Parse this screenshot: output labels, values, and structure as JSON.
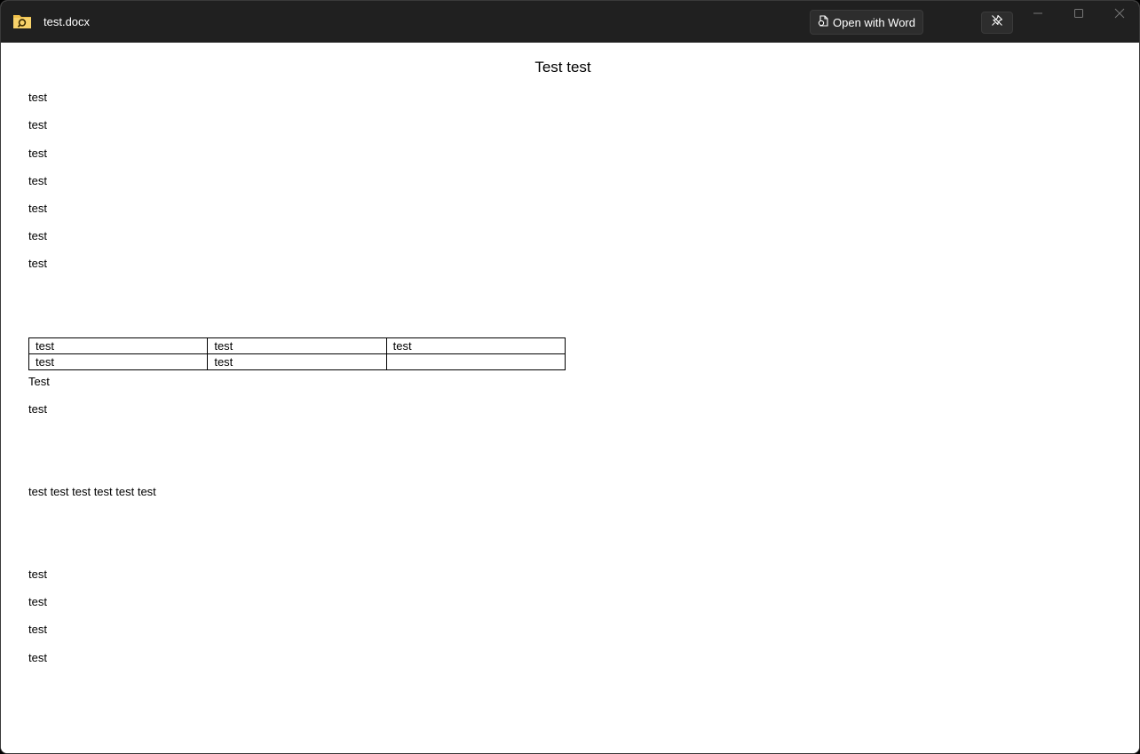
{
  "window": {
    "title": "test.docx",
    "open_with_label": "Open with Word",
    "icons": {
      "app": "folder-search-icon",
      "open_with": "word-document-icon",
      "pin": "unpin-icon",
      "minimize": "minimize-icon",
      "maximize": "maximize-icon",
      "close": "close-icon"
    },
    "colors": {
      "titlebar": "#202020",
      "folder": "#f0c04a"
    }
  },
  "document": {
    "title": "Test test",
    "paragraphs_top": [
      "test",
      "test",
      "test",
      "test",
      "test",
      "test",
      "test"
    ],
    "table": {
      "rows": [
        [
          "test",
          "test",
          "test"
        ],
        [
          "test",
          "test",
          ""
        ]
      ]
    },
    "after_table": [
      "Test",
      "test"
    ],
    "line": "test test test test test test",
    "paragraphs_bottom": [
      "test",
      "test",
      "test",
      "test"
    ]
  }
}
